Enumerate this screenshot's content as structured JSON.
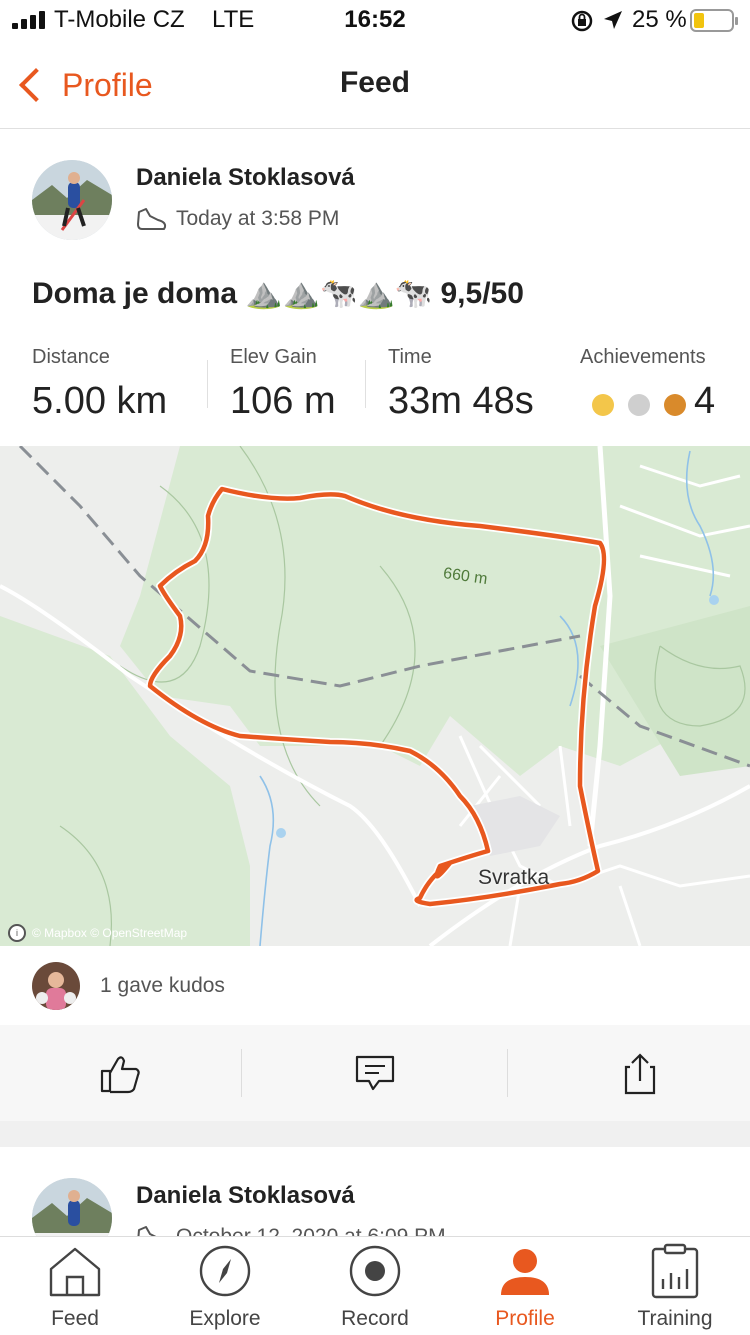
{
  "status_bar": {
    "carrier": "T-Mobile CZ",
    "network": "LTE",
    "time": "16:52",
    "battery": "25 %"
  },
  "nav": {
    "back_label": "Profile",
    "title": "Feed"
  },
  "activity": {
    "athlete": "Daniela Stoklasová",
    "timestamp": "Today at 3:58 PM",
    "title": "Doma je doma ⛰️⛰️🐄⛰️🐄 9,5/50",
    "stats": [
      {
        "label": "Distance",
        "value": "5.00 km"
      },
      {
        "label": "Elev Gain",
        "value": "106 m"
      },
      {
        "label": "Time",
        "value": "33m 48s"
      },
      {
        "label": "Achievements",
        "value": "4"
      }
    ],
    "map": {
      "elevation_label": "660 m",
      "town_label": "Svratka",
      "attribution": "© Mapbox © OpenStreetMap"
    },
    "kudos_text": "1 gave kudos"
  },
  "next_activity": {
    "athlete": "Daniela Stoklasová",
    "timestamp": "October 12, 2020 at 6:09 PM"
  },
  "tabs": [
    {
      "label": "Feed",
      "icon": "home-icon"
    },
    {
      "label": "Explore",
      "icon": "compass-icon"
    },
    {
      "label": "Record",
      "icon": "record-icon"
    },
    {
      "label": "Profile",
      "icon": "profile-icon"
    },
    {
      "label": "Training",
      "icon": "training-icon"
    }
  ],
  "colors": {
    "accent": "#e8581f",
    "gold": "#f3c64a",
    "silver": "#cfcfcf",
    "bronze": "#d98a2b"
  }
}
